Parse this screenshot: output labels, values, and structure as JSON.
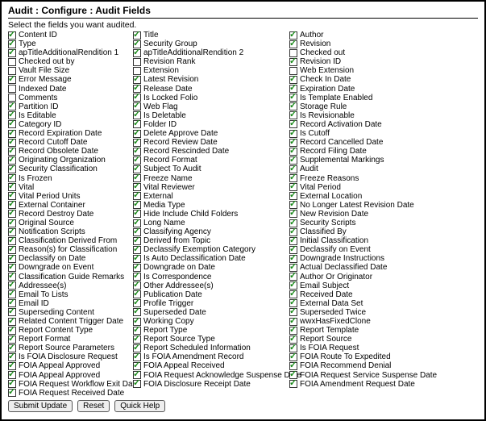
{
  "title": "Audit : Configure : Audit Fields",
  "instruction": "Select the fields you want audited.",
  "buttons": {
    "submit": "Submit Update",
    "reset": "Reset",
    "help": "Quick Help"
  },
  "columns": [
    [
      {
        "label": "Content ID",
        "checked": true
      },
      {
        "label": "Type",
        "checked": true
      },
      {
        "label": "apTitleAdditionalRendition 1",
        "checked": true
      },
      {
        "label": "Checked out by",
        "checked": false
      },
      {
        "label": "Vault File Size",
        "checked": false
      },
      {
        "label": "Error Message",
        "checked": true
      },
      {
        "label": "Indexed Date",
        "checked": false
      },
      {
        "label": "Comments",
        "checked": false
      },
      {
        "label": "Partition ID",
        "checked": true
      },
      {
        "label": "Is Editable",
        "checked": true
      },
      {
        "label": "Category ID",
        "checked": true
      },
      {
        "label": "Record Expiration Date",
        "checked": true
      },
      {
        "label": "Record Cutoff Date",
        "checked": true
      },
      {
        "label": "Record Obsolete Date",
        "checked": true
      },
      {
        "label": "Originating Organization",
        "checked": true
      },
      {
        "label": "Security Classification",
        "checked": true
      },
      {
        "label": "Is Frozen",
        "checked": true
      },
      {
        "label": "Vital",
        "checked": true
      },
      {
        "label": "Vital Period Units",
        "checked": true
      },
      {
        "label": "External Container",
        "checked": true
      },
      {
        "label": "Record Destroy Date",
        "checked": true
      },
      {
        "label": "Original Source",
        "checked": true
      },
      {
        "label": "Notification Scripts",
        "checked": true
      },
      {
        "label": "Classification Derived From",
        "checked": true
      },
      {
        "label": "Reason(s) for Classification",
        "checked": true
      },
      {
        "label": "Declassify on Date",
        "checked": true
      },
      {
        "label": "Downgrade on Event",
        "checked": true
      },
      {
        "label": "Classification Guide Remarks",
        "checked": true
      },
      {
        "label": "Addressee(s)",
        "checked": true
      },
      {
        "label": "Email To Lists",
        "checked": true
      },
      {
        "label": "Email ID",
        "checked": true
      },
      {
        "label": "Superseding Content",
        "checked": true
      },
      {
        "label": "Related Content Trigger Date",
        "checked": true
      },
      {
        "label": "Report Content Type",
        "checked": true
      },
      {
        "label": "Report Format",
        "checked": true
      },
      {
        "label": "Report Source Parameters",
        "checked": true
      },
      {
        "label": "Is FOIA Disclosure Request",
        "checked": true
      },
      {
        "label": "FOIA Appeal Approved",
        "checked": true
      },
      {
        "label": "FOIA Appeal Approved",
        "checked": true
      },
      {
        "label": "FOIA Request Workflow Exit Date",
        "checked": true
      },
      {
        "label": "FOIA Request Received Date",
        "checked": true
      }
    ],
    [
      {
        "label": "Title",
        "checked": true
      },
      {
        "label": "Security Group",
        "checked": true
      },
      {
        "label": "apTitleAdditionalRendition 2",
        "checked": true
      },
      {
        "label": "Revision Rank",
        "checked": false
      },
      {
        "label": "Extension",
        "checked": false
      },
      {
        "label": "Latest Revision",
        "checked": true
      },
      {
        "label": "Release Date",
        "checked": true
      },
      {
        "label": "Is Locked Folio",
        "checked": true
      },
      {
        "label": "Web Flag",
        "checked": true
      },
      {
        "label": "Is Deletable",
        "checked": true
      },
      {
        "label": "Folder ID",
        "checked": true
      },
      {
        "label": "Delete Approve Date",
        "checked": true
      },
      {
        "label": "Record Review Date",
        "checked": true
      },
      {
        "label": "Record Rescinded Date",
        "checked": true
      },
      {
        "label": "Record Format",
        "checked": true
      },
      {
        "label": "Subject To Audit",
        "checked": true
      },
      {
        "label": "Freeze Name",
        "checked": true
      },
      {
        "label": "Vital Reviewer",
        "checked": true
      },
      {
        "label": "External",
        "checked": true
      },
      {
        "label": "Media Type",
        "checked": true
      },
      {
        "label": "Hide Include Child Folders",
        "checked": true
      },
      {
        "label": "Long Name",
        "checked": true
      },
      {
        "label": "Classifying Agency",
        "checked": true
      },
      {
        "label": "Derived from Topic",
        "checked": true
      },
      {
        "label": "Declassify Exemption Category",
        "checked": true
      },
      {
        "label": "Is Auto Declassification Date",
        "checked": true
      },
      {
        "label": "Downgrade on Date",
        "checked": true
      },
      {
        "label": "Is Correspondence",
        "checked": true
      },
      {
        "label": "Other Addressee(s)",
        "checked": true
      },
      {
        "label": "Publication Date",
        "checked": true
      },
      {
        "label": "Profile Trigger",
        "checked": true
      },
      {
        "label": "Superseded Date",
        "checked": true
      },
      {
        "label": "Working Copy",
        "checked": true
      },
      {
        "label": "Report Type",
        "checked": true
      },
      {
        "label": "Report Source Type",
        "checked": true
      },
      {
        "label": "Report Scheduled Information",
        "checked": true
      },
      {
        "label": "Is FOIA Amendment Record",
        "checked": true
      },
      {
        "label": "FOIA Appeal Received",
        "checked": true
      },
      {
        "label": "FOIA Request Acknowledge Suspense Date",
        "checked": true
      },
      {
        "label": "FOIA Disclosure Receipt Date",
        "checked": true
      }
    ],
    [
      {
        "label": "Author",
        "checked": true
      },
      {
        "label": "Revision",
        "checked": true
      },
      {
        "label": "Checked out",
        "checked": false
      },
      {
        "label": "Revision ID",
        "checked": true
      },
      {
        "label": "Web Extension",
        "checked": false
      },
      {
        "label": "Check In Date",
        "checked": true
      },
      {
        "label": "Expiration Date",
        "checked": true
      },
      {
        "label": "Is Template Enabled",
        "checked": true
      },
      {
        "label": "Storage Rule",
        "checked": true
      },
      {
        "label": "Is Revisionable",
        "checked": true
      },
      {
        "label": "Record Activation Date",
        "checked": true
      },
      {
        "label": "Is Cutoff",
        "checked": true
      },
      {
        "label": "Record Cancelled Date",
        "checked": true
      },
      {
        "label": "Record Filing Date",
        "checked": true
      },
      {
        "label": "Supplemental Markings",
        "checked": true
      },
      {
        "label": "Audit",
        "checked": true
      },
      {
        "label": "Freeze Reasons",
        "checked": true
      },
      {
        "label": "Vital Period",
        "checked": true
      },
      {
        "label": "External Location",
        "checked": true
      },
      {
        "label": "No Longer Latest Revision Date",
        "checked": true
      },
      {
        "label": "New Revision Date",
        "checked": true
      },
      {
        "label": "Security Scripts",
        "checked": true
      },
      {
        "label": "Classified By",
        "checked": true
      },
      {
        "label": "Initial Classification",
        "checked": true
      },
      {
        "label": "Declassify on Event",
        "checked": true
      },
      {
        "label": "Downgrade Instructions",
        "checked": true
      },
      {
        "label": "Actual Declassified Date",
        "checked": true
      },
      {
        "label": "Author Or Originator",
        "checked": true
      },
      {
        "label": "Email Subject",
        "checked": true
      },
      {
        "label": "Received Date",
        "checked": true
      },
      {
        "label": "External Data Set",
        "checked": true
      },
      {
        "label": "Superseded Twice",
        "checked": true
      },
      {
        "label": "wwxHasFixedClone",
        "checked": true
      },
      {
        "label": "Report Template",
        "checked": true
      },
      {
        "label": "Report Source",
        "checked": true
      },
      {
        "label": "Is FOIA Request",
        "checked": true
      },
      {
        "label": "FOIA Route To Expedited",
        "checked": true
      },
      {
        "label": "FOIA Recommend Denial",
        "checked": true
      },
      {
        "label": "FOIA Request Service Suspense Date",
        "checked": true
      },
      {
        "label": "FOIA Amendment Request Date",
        "checked": true
      }
    ]
  ]
}
